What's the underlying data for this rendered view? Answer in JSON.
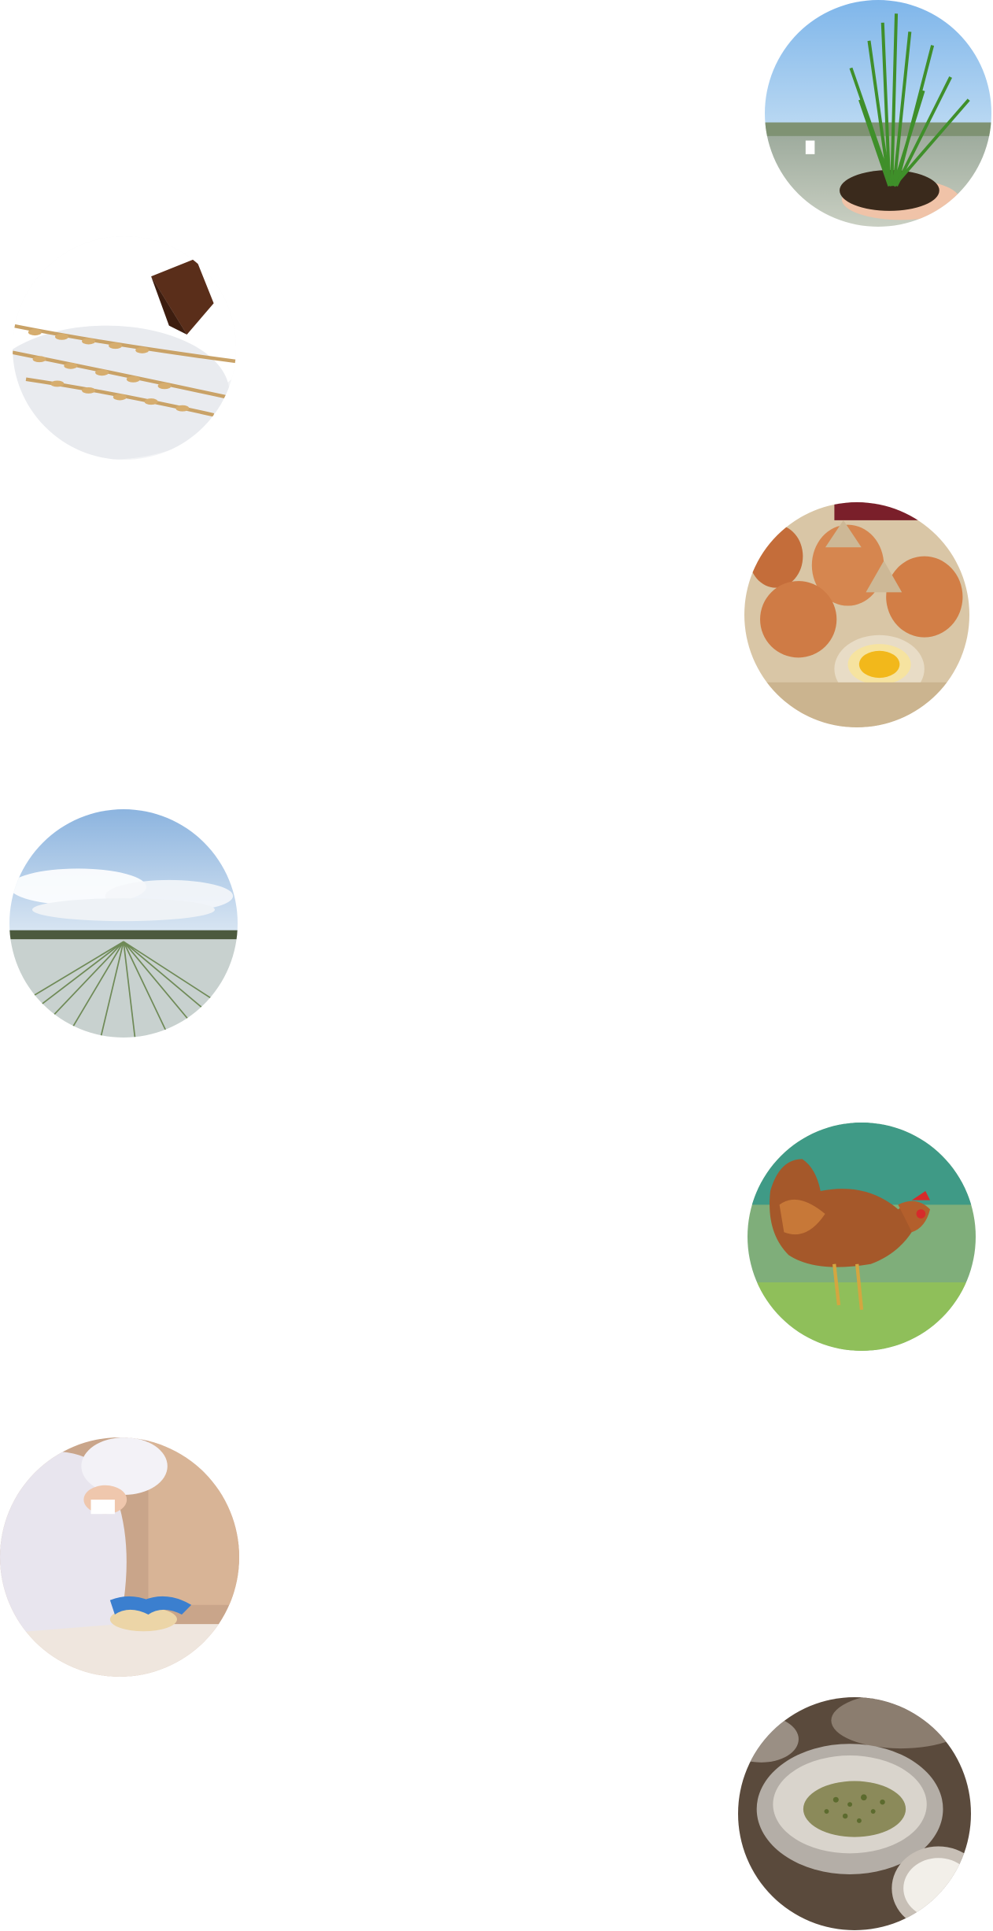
{
  "page": {
    "background": "#ffffff"
  },
  "photos": [
    {
      "id": "rice-seedlings",
      "subject": "rice-seedlings-in-hand"
    },
    {
      "id": "rice-flour",
      "subject": "rice-flour-with-scoop-and-ears"
    },
    {
      "id": "eggs",
      "subject": "brown-eggs-in-carton-with-cracked-yolk"
    },
    {
      "id": "rice-paddy",
      "subject": "flooded-rice-paddy-under-sky"
    },
    {
      "id": "chicken",
      "subject": "brown-hen-on-grass"
    },
    {
      "id": "baker",
      "subject": "worker-kneading-dough"
    },
    {
      "id": "herbs-bowl",
      "subject": "metal-bowl-of-herbs-and-flour"
    }
  ]
}
